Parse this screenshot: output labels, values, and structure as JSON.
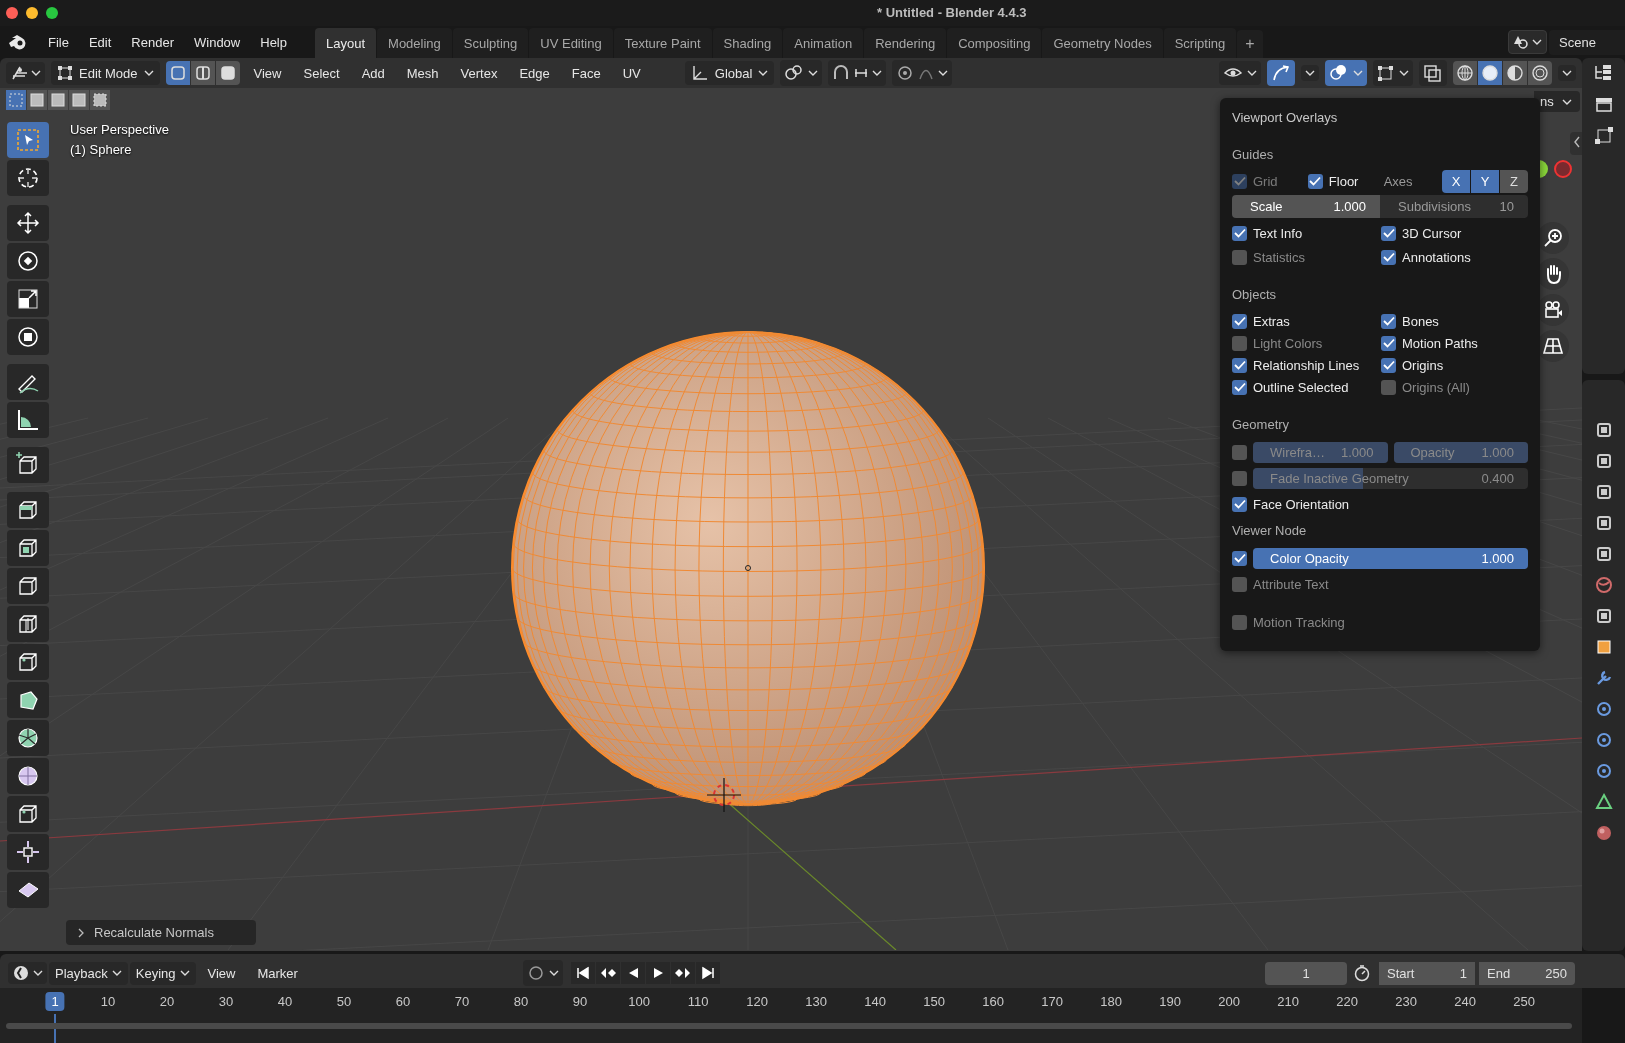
{
  "window": {
    "title": "* Untitled - Blender 4.4.3"
  },
  "menu": [
    "File",
    "Edit",
    "Render",
    "Window",
    "Help"
  ],
  "workspaces": [
    {
      "label": "Layout",
      "selected": true
    },
    {
      "label": "Modeling",
      "selected": false
    },
    {
      "label": "Sculpting",
      "selected": false
    },
    {
      "label": "UV Editing",
      "selected": false
    },
    {
      "label": "Texture Paint",
      "selected": false
    },
    {
      "label": "Shading",
      "selected": false
    },
    {
      "label": "Animation",
      "selected": false
    },
    {
      "label": "Rendering",
      "selected": false
    },
    {
      "label": "Compositing",
      "selected": false
    },
    {
      "label": "Geometry Nodes",
      "selected": false
    },
    {
      "label": "Scripting",
      "selected": false
    }
  ],
  "add_workspace": "+",
  "scene": "Scene",
  "header": {
    "mode": "Edit Mode",
    "select_modes": [
      {
        "selected": true
      },
      {
        "selected": false
      },
      {
        "selected": false
      }
    ],
    "menus": [
      "View",
      "Select",
      "Add",
      "Mesh",
      "Vertex",
      "Edge",
      "Face",
      "UV"
    ],
    "orientation": "Global",
    "overlays_on": true,
    "shading": [
      {
        "selected": false
      },
      {
        "selected": true
      },
      {
        "selected": false
      },
      {
        "selected": false
      }
    ],
    "box_modes": [
      {
        "selected": true
      },
      {
        "selected": false
      },
      {
        "selected": false
      },
      {
        "selected": false
      },
      {
        "selected": false
      }
    ],
    "partial_dropdown": "ns"
  },
  "viewport": {
    "info": [
      "User Perspective",
      "(1) Sphere"
    ],
    "tools": [
      {
        "selected": true
      },
      {
        "selected": false
      },
      {
        "selected": false
      },
      {
        "selected": false
      },
      {
        "selected": false
      },
      {
        "selected": false
      },
      {
        "selected": false
      },
      {
        "selected": false
      },
      {
        "selected": false
      },
      {
        "selected": false
      },
      {
        "selected": false
      },
      {
        "selected": false
      },
      {
        "selected": false
      },
      {
        "selected": false
      },
      {
        "selected": false
      },
      {
        "selected": false
      },
      {
        "selected": false
      },
      {
        "selected": false
      },
      {
        "selected": false
      },
      {
        "selected": false
      }
    ],
    "operator_panel": "Recalculate Normals"
  },
  "overlays": {
    "title": "Viewport Overlays",
    "guides": {
      "heading": "Guides",
      "grid": {
        "label": "Grid",
        "checked": true,
        "disabled": true
      },
      "floor": {
        "label": "Floor",
        "checked": true
      },
      "axes_label": "Axes",
      "axes": [
        {
          "label": "X",
          "selected": true
        },
        {
          "label": "Y",
          "selected": true
        },
        {
          "label": "Z",
          "selected": false
        }
      ],
      "scale": {
        "label": "Scale",
        "value": "1.000"
      },
      "subdivisions": {
        "label": "Subdivisions",
        "value": "10",
        "disabled": true
      },
      "options": [
        {
          "label": "Text Info",
          "checked": true
        },
        {
          "label": "3D Cursor",
          "checked": true
        },
        {
          "label": "Statistics",
          "checked": false
        },
        {
          "label": "Annotations",
          "checked": true
        }
      ]
    },
    "objects": {
      "heading": "Objects",
      "options": [
        {
          "label": "Extras",
          "checked": true
        },
        {
          "label": "Bones",
          "checked": true
        },
        {
          "label": "Light Colors",
          "checked": false
        },
        {
          "label": "Motion Paths",
          "checked": true
        },
        {
          "label": "Relationship Lines",
          "checked": true
        },
        {
          "label": "Origins",
          "checked": true
        },
        {
          "label": "Outline Selected",
          "checked": true
        },
        {
          "label": "Origins (All)",
          "checked": false
        }
      ]
    },
    "geometry": {
      "heading": "Geometry",
      "wireframe": {
        "checked": false,
        "label": "Wirefra…",
        "value": "1.000",
        "level": 1
      },
      "opacity": {
        "label": "Opacity",
        "value": "1.000",
        "level": 1
      },
      "fade": {
        "checked": false,
        "label": "Fade Inactive Geometry",
        "value": "0.400",
        "level": 0.4
      },
      "face_orientation": {
        "label": "Face Orientation",
        "checked": true
      }
    },
    "viewer_node": {
      "heading": "Viewer Node",
      "color_opacity": {
        "checked": true,
        "label": "Color Opacity",
        "value": "1.000",
        "level": 1
      },
      "attribute_text": {
        "label": "Attribute Text",
        "checked": false
      },
      "motion_tracking": {
        "label": "Motion Tracking",
        "checked": false
      }
    }
  },
  "timeline": {
    "menus": [
      {
        "label": "Playback",
        "kind": "dropdown"
      },
      {
        "label": "Keying",
        "kind": "dropdown"
      },
      {
        "label": "View",
        "kind": "menu"
      },
      {
        "label": "Marker",
        "kind": "menu"
      }
    ],
    "current_frame": "1",
    "start": {
      "label": "Start",
      "value": "1"
    },
    "end": {
      "label": "End",
      "value": "250"
    },
    "ruler": [
      {
        "label": "1",
        "selected": true
      },
      {
        "label": "10",
        "selected": false
      },
      {
        "label": "20",
        "selected": false
      },
      {
        "label": "30",
        "selected": false
      },
      {
        "label": "40",
        "selected": false
      },
      {
        "label": "50",
        "selected": false
      },
      {
        "label": "60",
        "selected": false
      },
      {
        "label": "70",
        "selected": false
      },
      {
        "label": "80",
        "selected": false
      },
      {
        "label": "90",
        "selected": false
      },
      {
        "label": "100",
        "selected": false
      },
      {
        "label": "110",
        "selected": false
      },
      {
        "label": "120",
        "selected": false
      },
      {
        "label": "130",
        "selected": false
      },
      {
        "label": "140",
        "selected": false
      },
      {
        "label": "150",
        "selected": false
      },
      {
        "label": "160",
        "selected": false
      },
      {
        "label": "170",
        "selected": false
      },
      {
        "label": "180",
        "selected": false
      },
      {
        "label": "190",
        "selected": false
      },
      {
        "label": "200",
        "selected": false
      },
      {
        "label": "210",
        "selected": false
      },
      {
        "label": "220",
        "selected": false
      },
      {
        "label": "230",
        "selected": false
      },
      {
        "label": "240",
        "selected": false
      },
      {
        "label": "250",
        "selected": false
      }
    ]
  }
}
